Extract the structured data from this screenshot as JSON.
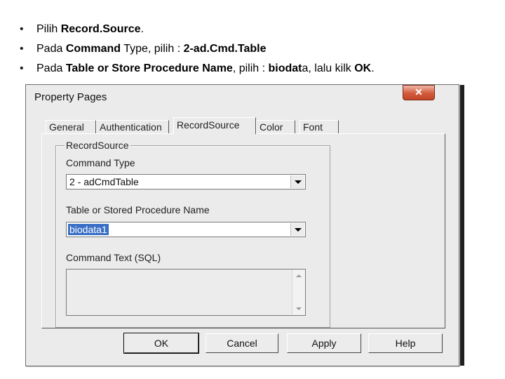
{
  "bullets": [
    {
      "pre": "Pilih ",
      "b1": "Record.Source",
      "mid": ".",
      "b2": "",
      "mid2": "",
      "b3": "",
      "post": ""
    },
    {
      "pre": "Pada ",
      "b1": "Command",
      "mid": " Type, pilih : ",
      "b2": "2-ad.Cmd.Table",
      "mid2": "",
      "b3": "",
      "post": ""
    },
    {
      "pre": "Pada ",
      "b1": "Table or Store Procedure Name",
      "mid": ", pilih : ",
      "b2": "biodat",
      "mid2": "a, lalu kilk ",
      "b3": "OK",
      "post": "."
    }
  ],
  "dialog": {
    "title": "Property Pages",
    "close_label": "✕"
  },
  "tabs": [
    "General",
    "Authentication",
    "RecordSource",
    "Color",
    "Font"
  ],
  "active_tab": "RecordSource",
  "group": {
    "legend": "RecordSource",
    "command_type_label": "Command Type",
    "command_type_value": "2 - adCmdTable",
    "table_label": "Table or Stored Procedure Name",
    "table_value": "biodata1",
    "command_text_label": "Command Text (SQL)",
    "command_text_value": ""
  },
  "buttons": {
    "ok": "OK",
    "cancel": "Cancel",
    "apply": "Apply",
    "help": "Help"
  }
}
